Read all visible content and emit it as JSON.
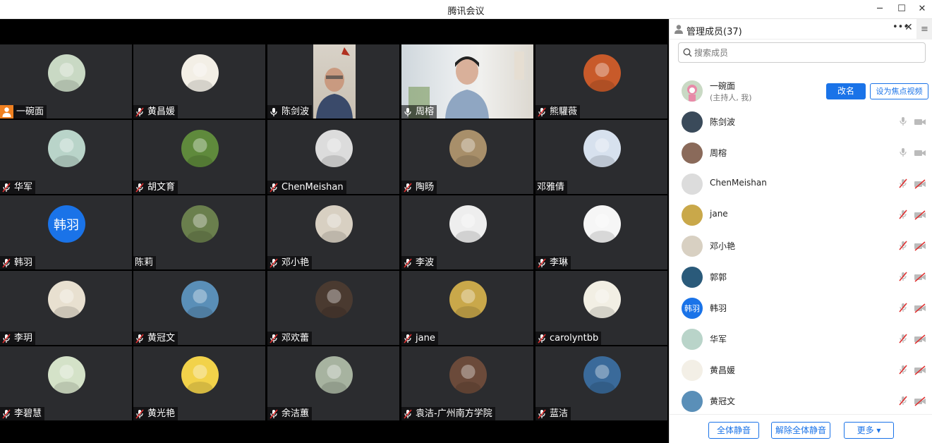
{
  "window": {
    "title": "腾讯会议",
    "minimize_icon": "minimize-icon",
    "maximize_icon": "maximize-icon",
    "close_icon": "close-icon"
  },
  "tiles": [
    {
      "name": "一碗面",
      "type": "host",
      "avatar_color": "#c9d9c4"
    },
    {
      "name": "黄昌媛",
      "type": "muted",
      "avatar_color": "#f3efe6"
    },
    {
      "name": "陈剑波",
      "type": "mic",
      "video": true
    },
    {
      "name": "周榕",
      "type": "mic",
      "video": true
    },
    {
      "name": "熊驩薇",
      "type": "muted",
      "avatar_color": "#c85a2a"
    },
    {
      "name": "华军",
      "type": "muted",
      "avatar_color": "#b9d4c9"
    },
    {
      "name": "胡文育",
      "type": "muted",
      "avatar_color": "#5f8a3c"
    },
    {
      "name": "ChenMeishan",
      "type": "muted",
      "avatar_color": "#dcdcdc"
    },
    {
      "name": "陶旸",
      "type": "muted",
      "avatar_color": "#a88f6a"
    },
    {
      "name": "邓雅倩",
      "type": "none",
      "avatar_color": "#d7e1ee"
    },
    {
      "name": "韩羽",
      "type": "muted",
      "avatar_text": "韩羽"
    },
    {
      "name": "陈莉",
      "type": "none",
      "avatar_color": "#6a7f4d"
    },
    {
      "name": "邓小艳",
      "type": "muted",
      "avatar_color": "#d8d0c2"
    },
    {
      "name": "李波",
      "type": "muted",
      "avatar_color": "#eeeeee"
    },
    {
      "name": "李琳",
      "type": "muted",
      "avatar_color": "#f6f6f6"
    },
    {
      "name": "李玥",
      "type": "muted",
      "avatar_color": "#e8e0d0"
    },
    {
      "name": "黄冠文",
      "type": "muted",
      "avatar_color": "#5a8fb8"
    },
    {
      "name": "邓欢蕾",
      "type": "muted",
      "avatar_color": "#4a3a30"
    },
    {
      "name": "jane",
      "type": "muted",
      "avatar_color": "#c9a84a"
    },
    {
      "name": "carolyntbb",
      "type": "muted",
      "avatar_color": "#f2efe4"
    },
    {
      "name": "李碧慧",
      "type": "muted",
      "avatar_color": "#d4e2c8"
    },
    {
      "name": "黄光艳",
      "type": "muted",
      "avatar_color": "#f2d24a"
    },
    {
      "name": "余洁蕙",
      "type": "muted",
      "avatar_color": "#a7b3a0"
    },
    {
      "name": "袁洁-广州南方学院",
      "type": "muted",
      "avatar_color": "#6b4a3a"
    },
    {
      "name": "蓝洁",
      "type": "muted",
      "avatar_color": "#3a6a9a"
    }
  ],
  "panel": {
    "title": "管理成员(37)",
    "search_placeholder": "搜索成员",
    "more_icon": "more-icon",
    "menu_icon": "menu-icon",
    "host": {
      "name": "一碗面",
      "sub": "(主持人, 我)",
      "rename_label": "改名",
      "focus_label": "设为焦点视频"
    },
    "members": [
      {
        "name": "陈剑波",
        "muted": false,
        "avatar_color": "#3a4a5a"
      },
      {
        "name": "周榕",
        "muted": false,
        "avatar_color": "#8a6a5a"
      },
      {
        "name": "ChenMeishan",
        "muted": true,
        "avatar_color": "#dcdcdc"
      },
      {
        "name": "jane",
        "muted": true,
        "avatar_color": "#c9a84a"
      },
      {
        "name": "邓小艳",
        "muted": true,
        "avatar_color": "#d8d0c2"
      },
      {
        "name": "郭郭",
        "muted": true,
        "avatar_color": "#2a5a7a"
      },
      {
        "name": "韩羽",
        "muted": true,
        "avatar_text": "韩羽"
      },
      {
        "name": "华军",
        "muted": true,
        "avatar_color": "#b9d4c9"
      },
      {
        "name": "黄昌媛",
        "muted": true,
        "avatar_color": "#f3efe6"
      },
      {
        "name": "黄冠文",
        "muted": true,
        "avatar_color": "#5a8fb8"
      }
    ],
    "footer": {
      "mute_all": "全体静音",
      "unmute_all": "解除全体静音",
      "more": "更多 ▾"
    }
  }
}
